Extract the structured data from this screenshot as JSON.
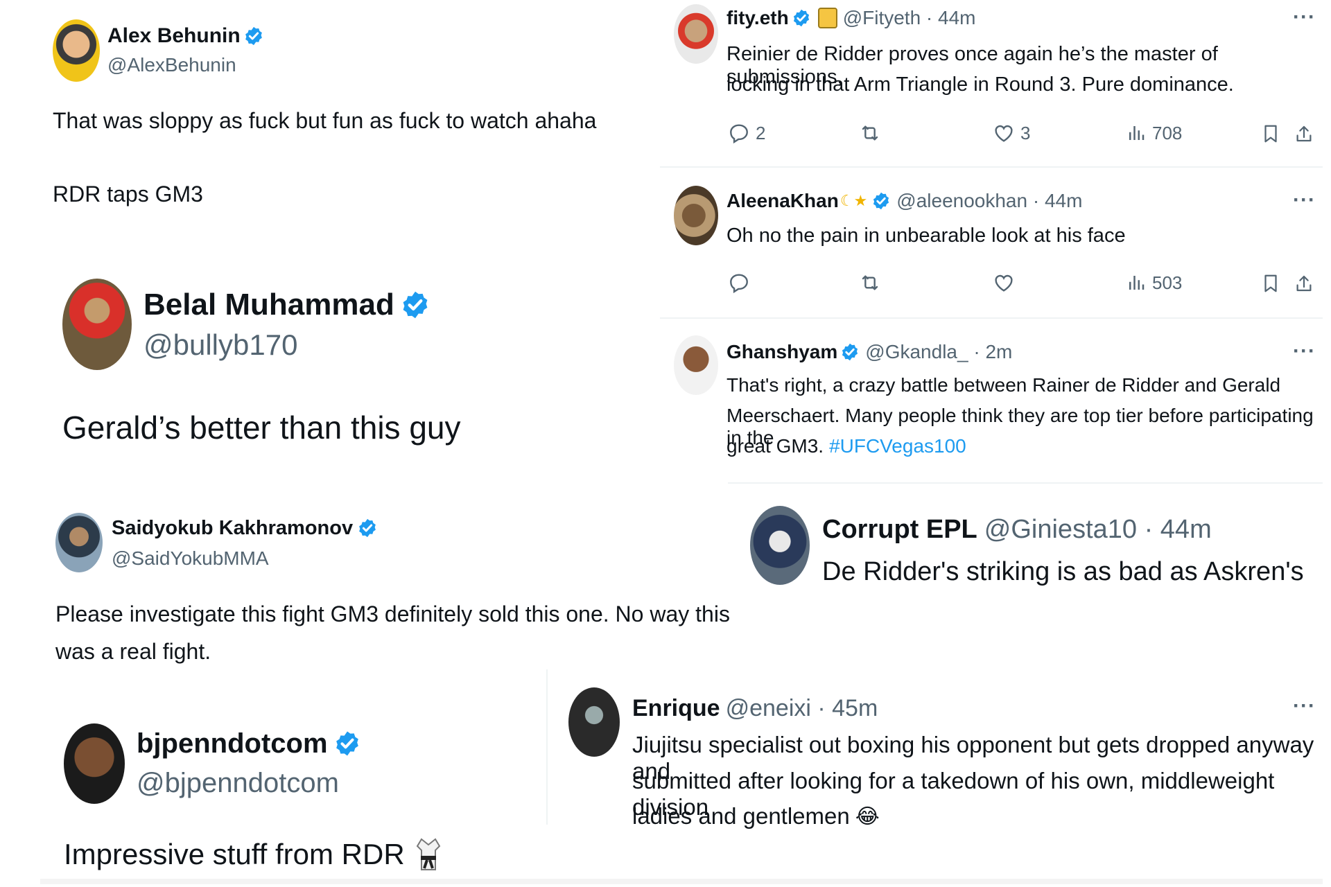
{
  "colors": {
    "verified": "#1d9bf0",
    "link": "#1d9bf0",
    "text": "#0f1419",
    "muted": "#536471"
  },
  "alex": {
    "name": "Alex Behunin",
    "handle": "@AlexBehunin",
    "line1": "That was sloppy as fuck but fun as fuck to watch ahaha",
    "line2": "RDR taps GM3"
  },
  "belal": {
    "name": "Belal Muhammad",
    "handle": "@bullyb170",
    "text": "Gerald’s better than this guy"
  },
  "saidyokub": {
    "name": "Saidyokub Kakhramonov",
    "handle": "@SaidYokubMMA",
    "line1": "Please investigate this fight GM3 definitely sold this one. No way this",
    "line2": "was a real fight."
  },
  "bjpenn": {
    "name": "bjpenndotcom",
    "handle": "@bjpenndotcom",
    "text": "Impressive stuff from RDR"
  },
  "fity": {
    "name": "fity.eth",
    "handle": "@Fityeth · 44m",
    "line1": "Reinier de Ridder proves once again he’s the master of submissions,",
    "line2": "locking in that Arm Triangle in Round 3. Pure dominance.",
    "replies": "2",
    "likes": "3",
    "views": "708",
    "more": "···"
  },
  "aleena": {
    "name": "AleenaKhan",
    "handle": "@aleenookhan · 44m",
    "text": "Oh no the pain in unbearable look at his face",
    "views": "503",
    "more": "···"
  },
  "ghanshyam": {
    "name": "Ghanshyam",
    "handle": "@Gkandla_ · 2m",
    "line1": "That's right, a crazy battle between Rainer de Ridder and Gerald",
    "line2": "Meerschaert. Many people think they are top tier before participating in the",
    "line3": "great GM3.",
    "hashtag": "#UFCVegas100",
    "more": "···"
  },
  "corrupt": {
    "name": "Corrupt EPL",
    "handle": "@Giniesta10 · 44m",
    "text": "De Ridder's striking is as bad as Askren's"
  },
  "enrique": {
    "name": "Enrique",
    "handle": "@eneixi · 45m",
    "line1": "Jiujitsu specialist out boxing his opponent but gets dropped anyway and",
    "line2": "submitted after looking for a takedown of his own, middleweight division",
    "line3": "ladies and gentlemen",
    "emoji": "😂",
    "more": "···"
  },
  "icons": [
    "verified-badge-icon",
    "reply-icon",
    "retweet-icon",
    "like-icon",
    "views-icon",
    "bookmark-icon",
    "share-icon",
    "more-icon",
    "judo-gi-icon"
  ]
}
